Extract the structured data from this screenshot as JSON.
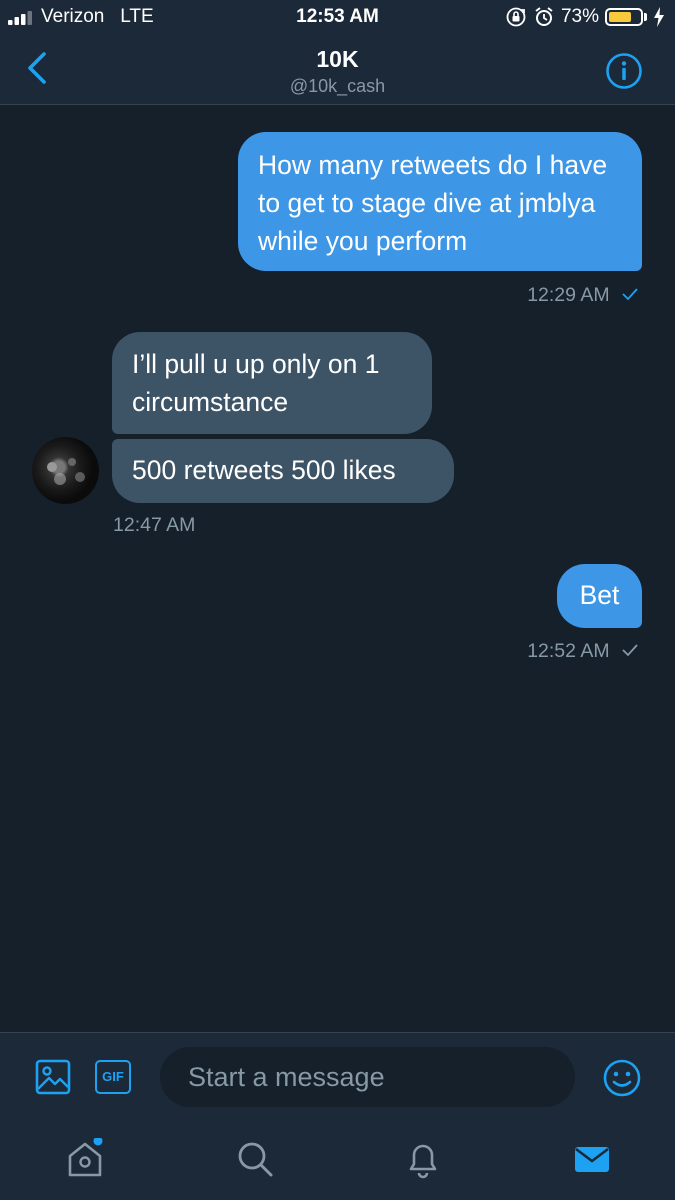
{
  "status_bar": {
    "carrier": "Verizon",
    "network": "LTE",
    "time": "12:53 AM",
    "battery_percent_label": "73%",
    "battery_level": 0.73,
    "icons": [
      "signal-icon",
      "orientation-lock-icon",
      "alarm-icon",
      "battery-icon",
      "charging-bolt-icon"
    ]
  },
  "header": {
    "title": "10K",
    "handle": "@10k_cash",
    "icons": [
      "back-chevron-icon",
      "info-icon"
    ]
  },
  "conversation": {
    "messages": [
      {
        "direction": "sent",
        "text": "How many retweets do I have to get to stage dive at jmblya while you perform"
      },
      {
        "direction": "received",
        "text": "I’ll pull u up only on 1 circumstance"
      },
      {
        "direction": "received",
        "text": "500 retweets 500 likes"
      },
      {
        "direction": "sent",
        "text": "Bet"
      }
    ],
    "timestamps": {
      "first_sent": "12:29 AM",
      "received": "12:47 AM",
      "second_sent": "12:52 AM"
    },
    "read_receipt_icon": "checkmark-icon"
  },
  "composer": {
    "placeholder": "Start a message",
    "icons": [
      "image-icon",
      "gif-icon",
      "emoji-icon"
    ],
    "gif_label": "GIF"
  },
  "tabbar": {
    "items": [
      "home-icon",
      "search-icon",
      "notifications-icon",
      "messages-icon"
    ],
    "active": "messages-icon"
  },
  "colors": {
    "background": "#15202b",
    "bar": "#1c2938",
    "accent": "#1da1f2",
    "sent_bubble": "#3d96e6",
    "received_bubble": "#3d5466",
    "muted_text": "#8899a6",
    "battery_fill": "#f8c93a"
  }
}
